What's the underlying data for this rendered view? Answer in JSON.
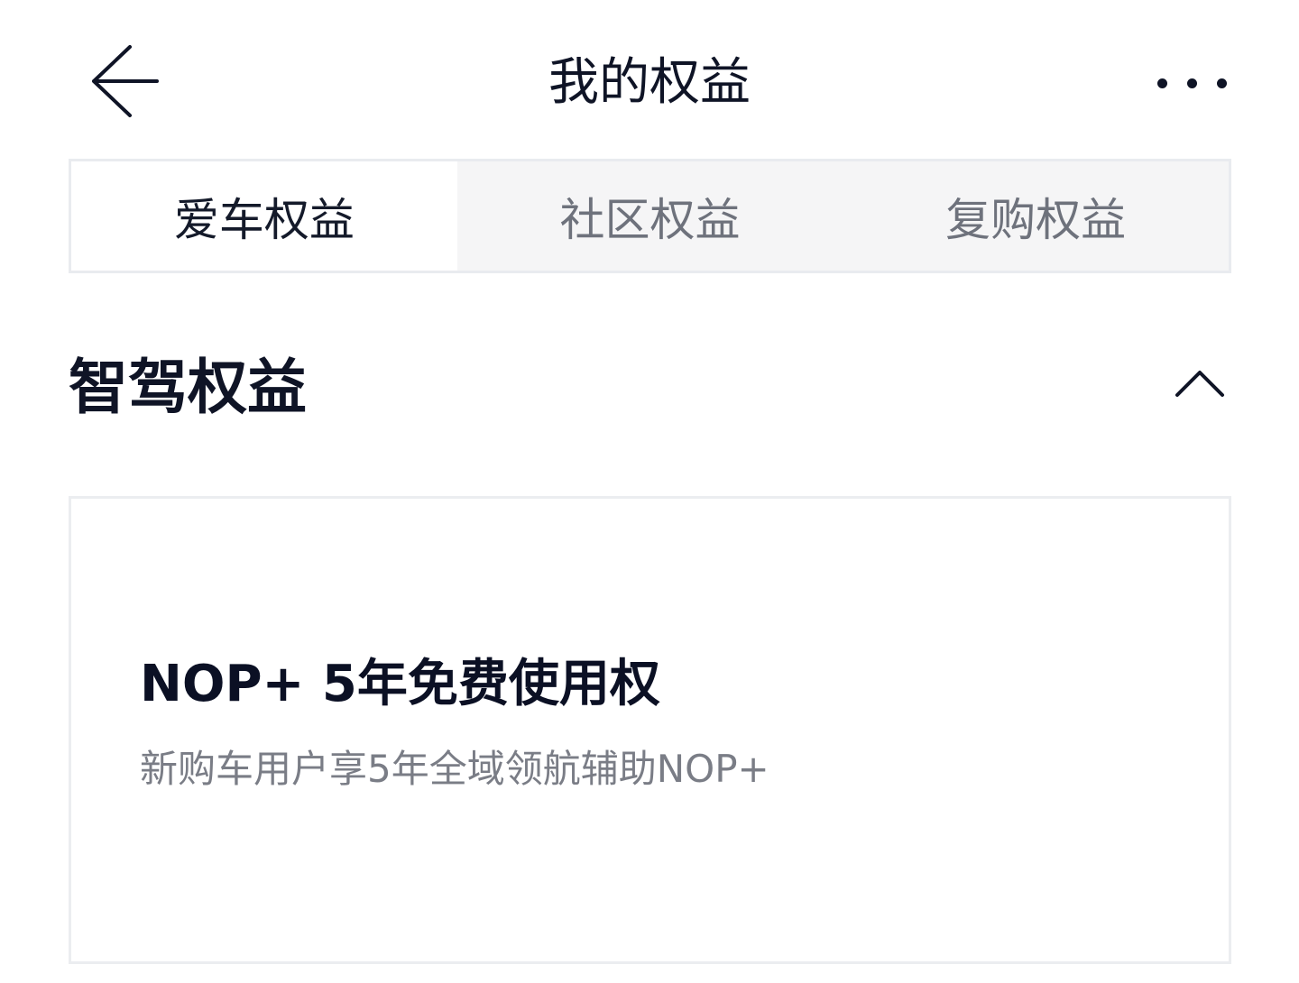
{
  "header": {
    "title": "我的权益",
    "back_icon": "arrow-left-icon",
    "more_icon": "more-dots-icon"
  },
  "tabs": [
    {
      "label": "爱车权益",
      "active": true
    },
    {
      "label": "社区权益",
      "active": false
    },
    {
      "label": "复购权益",
      "active": false
    }
  ],
  "section": {
    "title": "智驾权益",
    "toggle_icon": "chevron-up-icon"
  },
  "card": {
    "title": "NOP+ 5年免费使用权",
    "description": "新购车用户享5年全域领航辅助NOP+"
  },
  "colors": {
    "text_primary": "#0f1426",
    "text_secondary": "#7a7d86",
    "tab_inactive_bg": "#f5f5f6",
    "border": "#e9ebef"
  }
}
